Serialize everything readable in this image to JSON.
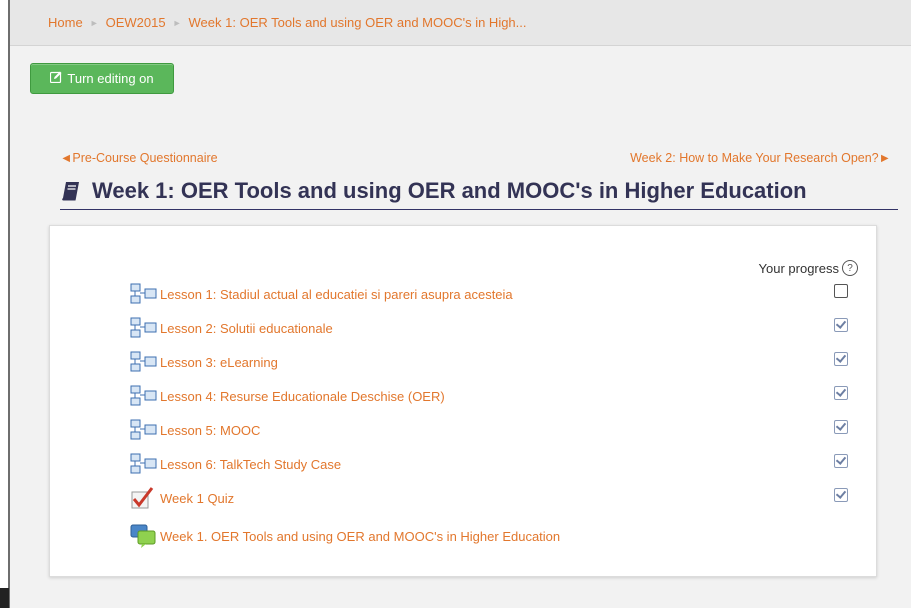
{
  "breadcrumb": {
    "items": [
      "Home",
      "OEW2015",
      "Week 1: OER Tools and using OER and MOOC's in High..."
    ]
  },
  "toolbar": {
    "edit_label": "Turn editing on"
  },
  "nav": {
    "prev_label": "◄Pre-Course Questionnaire",
    "next_label": "Week 2: How to Make Your Research Open?►"
  },
  "page": {
    "title": "Week 1: OER Tools and using OER and MOOC's in Higher Education"
  },
  "progress": {
    "label": "Your progress",
    "help": "?"
  },
  "activities": [
    {
      "label": "Lesson 1: Stadiul actual al educatiei si pareri asupra acesteia",
      "type": "lesson",
      "done": false
    },
    {
      "label": "Lesson 2: Solutii educationale",
      "type": "lesson",
      "done": true
    },
    {
      "label": "Lesson 3: eLearning",
      "type": "lesson",
      "done": true
    },
    {
      "label": "Lesson 4: Resurse Educationale Deschise (OER)",
      "type": "lesson",
      "done": true
    },
    {
      "label": "Lesson 5: MOOC",
      "type": "lesson",
      "done": true
    },
    {
      "label": "Lesson 6: TalkTech Study Case",
      "type": "lesson",
      "done": true
    },
    {
      "label": "Week 1 Quiz",
      "type": "quiz",
      "done": true
    },
    {
      "label": "Week 1. OER Tools and using OER and MOOC's in Higher Education",
      "type": "forum",
      "done": null
    }
  ],
  "colors": {
    "link": "#e2772d",
    "button": "#5bb75b",
    "title": "#333355"
  }
}
